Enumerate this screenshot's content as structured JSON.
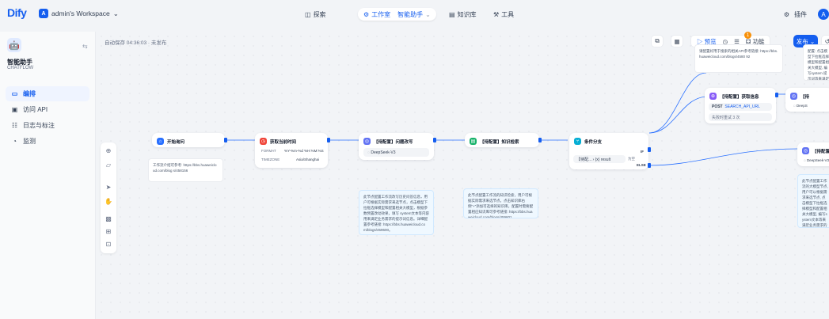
{
  "topbar": {
    "logo": "Dify",
    "workspace": {
      "initial": "A",
      "name": "admin's Workspace"
    },
    "nav": {
      "explore": "探索",
      "studio": "工作室",
      "current_app": "智能助手",
      "knowledge": "知识库",
      "tools": "工具"
    },
    "plugins": "插件",
    "user_initial": "A"
  },
  "sidebar": {
    "app_name": "智能助手",
    "app_type": "CHATFLOW",
    "items": [
      {
        "label": "编排",
        "icon": "layout-icon",
        "active": true
      },
      {
        "label": "访问 API",
        "icon": "terminal-icon",
        "active": false
      },
      {
        "label": "日志与标注",
        "icon": "logs-icon",
        "active": false
      },
      {
        "label": "监测",
        "icon": "monitor-icon",
        "active": false
      }
    ]
  },
  "canvas": {
    "autosave": "自动保存 04:36:03 · 未发布",
    "preview": "预览",
    "features": "功能",
    "publish": "发布",
    "badge_count": "1"
  },
  "nodes": {
    "start": {
      "title": "开始询问",
      "note": "工作流介绍可参考: https://bbs.huaweicloud.com/blog s/458156"
    },
    "datetime": {
      "title": "获取当前时间",
      "format_key": "FORMAT",
      "format_val": "%Y-%m-%d %H:%M:%S",
      "tz_key": "TIMEZONE",
      "tz_val": "Asia/Shanghai"
    },
    "llm1": {
      "title": "【待配置】问题改写",
      "model": "DeepSeek-V3",
      "note": "此节点配置工作流改写历史问答信息，用户可根据实际需求来选节点，点击模型下拉框选择模型和配置相关大模型，根据参数预置改动效果，填写 system文本等内容用来满足业务需求的提示词信息。详细配置参考链接: https://bbs.huaweicloud.com/blogs/459600。"
    },
    "kb": {
      "title": "【待配置】知识检索",
      "note": "此节点配置工作流的知识检索，用户可根据实际需求来选节点。点击知识库右侧“+”添加可选择的知识库。配置时需要配置相应知识库可参考链接: https://bbs.huaweicloud.com/blogs/459601"
    },
    "branch": {
      "title": "条件分支",
      "if_label": "IF",
      "cond_var": "【待配... › {x} result",
      "cond_op": "为空",
      "else_label": "ELSE"
    },
    "http": {
      "title": "【待配置】获取信息",
      "method": "POST",
      "url": "SEARCH_API_URL",
      "retry": "失败时重试 3 次"
    },
    "top_note": "请配置好用于搜索的相关API参考链接: https://bbs.huaweicloud.com/blogs/4580 92",
    "right_top_note": "配置: 点击模型下拉框选择模型和配置相关大模型, 编写system 提示词等来满足业务需求的提示词信息。详细配置参考: https://bbs.huaw",
    "partial_top": {
      "title": "【待",
      "model": "DeepS"
    },
    "llm2": {
      "title": "【待配置】",
      "model": "DeepSeek-V3",
      "note": "此节点配置工作流的大模型节点, 用户可以根据需求来选节点, 点击模型下拉框选择模型和配置相关大模型, 编写system文本等来满足业务需求的提示词信息。详细配置参考链接: https://bbs.huaweicloud.com/blogs/459660"
    }
  },
  "colors": {
    "accent": "#155eef",
    "start": "#2970ff",
    "datetime": "#f04438",
    "llm": "#6172f3",
    "kb": "#17b26a",
    "branch": "#06aed4",
    "http": "#875bf7"
  }
}
